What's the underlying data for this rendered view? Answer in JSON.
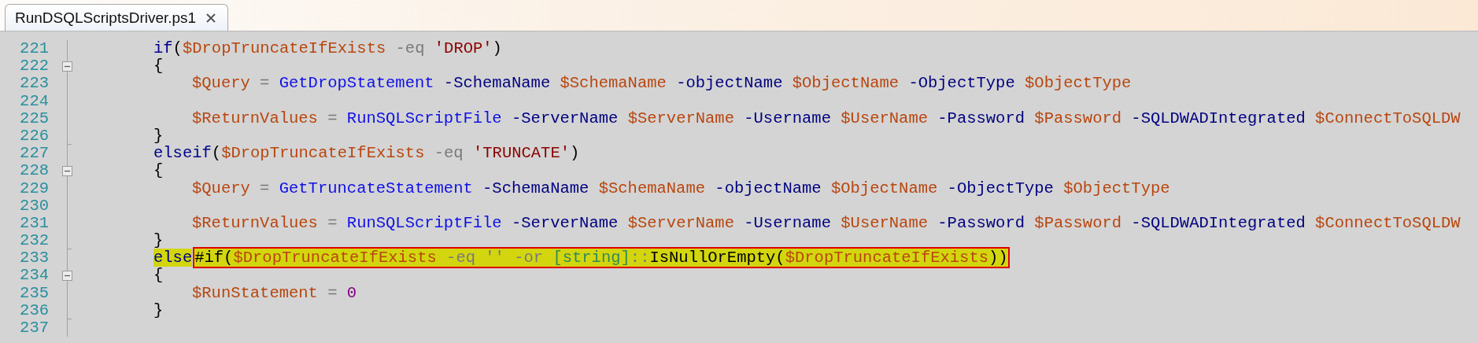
{
  "tabs": [
    {
      "label": "RunDSQLScriptsDriver.ps1",
      "selected": true
    }
  ],
  "editor": {
    "lines": [
      {
        "number": "221",
        "kind": "branch",
        "collapsible": false,
        "block_end": false,
        "tokens": [
          {
            "kind": "keyword",
            "text": "if"
          },
          {
            "kind": "plain",
            "text": "("
          },
          {
            "kind": "variable",
            "text": "$DropTruncateIfExists"
          },
          {
            "kind": "operator",
            "text": " -eq "
          },
          {
            "kind": "string",
            "text": "'DROP'"
          },
          {
            "kind": "plain",
            "text": ")"
          }
        ]
      },
      {
        "number": "222",
        "kind": "branch",
        "collapsible": true,
        "block_end": false,
        "tokens": [
          {
            "kind": "plain",
            "text": "{"
          }
        ]
      },
      {
        "number": "223",
        "kind": "body",
        "collapsible": false,
        "block_end": false,
        "tokens": [
          {
            "kind": "variable",
            "text": "$Query"
          },
          {
            "kind": "operator",
            "text": " = "
          },
          {
            "kind": "command",
            "text": "GetDropStatement"
          },
          {
            "kind": "parameter",
            "text": " -SchemaName "
          },
          {
            "kind": "variable",
            "text": "$SchemaName"
          },
          {
            "kind": "parameter",
            "text": " -objectName "
          },
          {
            "kind": "variable",
            "text": "$ObjectName"
          },
          {
            "kind": "parameter",
            "text": " -ObjectType "
          },
          {
            "kind": "variable",
            "text": "$ObjectType"
          }
        ]
      },
      {
        "number": "224",
        "kind": "body",
        "collapsible": false,
        "block_end": false
      },
      {
        "number": "225",
        "kind": "body",
        "collapsible": false,
        "block_end": false,
        "tokens": [
          {
            "kind": "variable",
            "text": "$ReturnValues"
          },
          {
            "kind": "operator",
            "text": " = "
          },
          {
            "kind": "command",
            "text": "RunSQLScriptFile"
          },
          {
            "kind": "parameter",
            "text": " -ServerName "
          },
          {
            "kind": "variable",
            "text": "$ServerName"
          },
          {
            "kind": "parameter",
            "text": " -Username "
          },
          {
            "kind": "variable",
            "text": "$UserName"
          },
          {
            "kind": "parameter",
            "text": " -Password "
          },
          {
            "kind": "variable",
            "text": "$Password"
          },
          {
            "kind": "parameter",
            "text": " -SQLDWADIntegrated "
          },
          {
            "kind": "variable",
            "text": "$ConnectToSQLDW"
          }
        ]
      },
      {
        "number": "226",
        "kind": "branch",
        "collapsible": false,
        "block_end": true,
        "tokens": [
          {
            "kind": "plain",
            "text": "}"
          }
        ]
      },
      {
        "number": "227",
        "kind": "branch",
        "collapsible": false,
        "block_end": false,
        "tokens": [
          {
            "kind": "keyword",
            "text": "elseif"
          },
          {
            "kind": "plain",
            "text": "("
          },
          {
            "kind": "variable",
            "text": "$DropTruncateIfExists"
          },
          {
            "kind": "operator",
            "text": " -eq "
          },
          {
            "kind": "string",
            "text": "'TRUNCATE'"
          },
          {
            "kind": "plain",
            "text": ")"
          }
        ]
      },
      {
        "number": "228",
        "kind": "branch",
        "collapsible": true,
        "block_end": false,
        "tokens": [
          {
            "kind": "plain",
            "text": "{"
          }
        ]
      },
      {
        "number": "229",
        "kind": "body",
        "collapsible": false,
        "block_end": false,
        "tokens": [
          {
            "kind": "variable",
            "text": "$Query"
          },
          {
            "kind": "operator",
            "text": " = "
          },
          {
            "kind": "command",
            "text": "GetTruncateStatement"
          },
          {
            "kind": "parameter",
            "text": " -SchemaName "
          },
          {
            "kind": "variable",
            "text": "$SchemaName"
          },
          {
            "kind": "parameter",
            "text": " -objectName "
          },
          {
            "kind": "variable",
            "text": "$ObjectName"
          },
          {
            "kind": "parameter",
            "text": " -ObjectType "
          },
          {
            "kind": "variable",
            "text": "$ObjectType"
          }
        ]
      },
      {
        "number": "230",
        "kind": "body",
        "collapsible": false,
        "block_end": false
      },
      {
        "number": "231",
        "kind": "body",
        "collapsible": false,
        "block_end": false,
        "tokens": [
          {
            "kind": "variable",
            "text": "$ReturnValues"
          },
          {
            "kind": "operator",
            "text": " = "
          },
          {
            "kind": "command",
            "text": "RunSQLScriptFile"
          },
          {
            "kind": "parameter",
            "text": " -ServerName "
          },
          {
            "kind": "variable",
            "text": "$ServerName"
          },
          {
            "kind": "parameter",
            "text": " -Username "
          },
          {
            "kind": "variable",
            "text": "$UserName"
          },
          {
            "kind": "parameter",
            "text": " -Password "
          },
          {
            "kind": "variable",
            "text": "$Password"
          },
          {
            "kind": "parameter",
            "text": " -SQLDWADIntegrated "
          },
          {
            "kind": "variable",
            "text": "$ConnectToSQLDW"
          }
        ]
      },
      {
        "number": "232",
        "kind": "branch",
        "collapsible": false,
        "block_end": true,
        "tokens": [
          {
            "kind": "plain",
            "text": "}"
          }
        ]
      },
      {
        "number": "233",
        "kind": "branch",
        "collapsible": false,
        "block_end": false,
        "tokens": [
          {
            "kind": "keyword",
            "text": "else",
            "highlighted": true
          },
          {
            "kind": "outline",
            "highlighted": true,
            "tokens": [
              {
                "kind": "plain",
                "text": "#if("
              },
              {
                "kind": "variable",
                "text": "$DropTruncateIfExists"
              },
              {
                "kind": "operator",
                "text": " -eq '' -or "
              },
              {
                "kind": "type",
                "text": "[string]"
              },
              {
                "kind": "operator",
                "text": "::"
              },
              {
                "kind": "plain",
                "text": "IsNullOrEmpty("
              },
              {
                "kind": "variable",
                "text": "$DropTruncateIfExists"
              },
              {
                "kind": "plain",
                "text": "))"
              }
            ]
          }
        ]
      },
      {
        "number": "234",
        "kind": "branch",
        "collapsible": true,
        "block_end": false,
        "tokens": [
          {
            "kind": "plain",
            "text": "{"
          }
        ]
      },
      {
        "number": "235",
        "kind": "body",
        "collapsible": false,
        "block_end": false,
        "tokens": [
          {
            "kind": "variable",
            "text": "$RunStatement"
          },
          {
            "kind": "operator",
            "text": " = "
          },
          {
            "kind": "number",
            "text": "0"
          }
        ]
      },
      {
        "number": "236",
        "kind": "branch",
        "collapsible": false,
        "block_end": true,
        "tokens": [
          {
            "kind": "plain",
            "text": "}"
          }
        ]
      },
      {
        "number": "237",
        "kind": "branch",
        "collapsible": false,
        "block_end": false
      }
    ]
  }
}
